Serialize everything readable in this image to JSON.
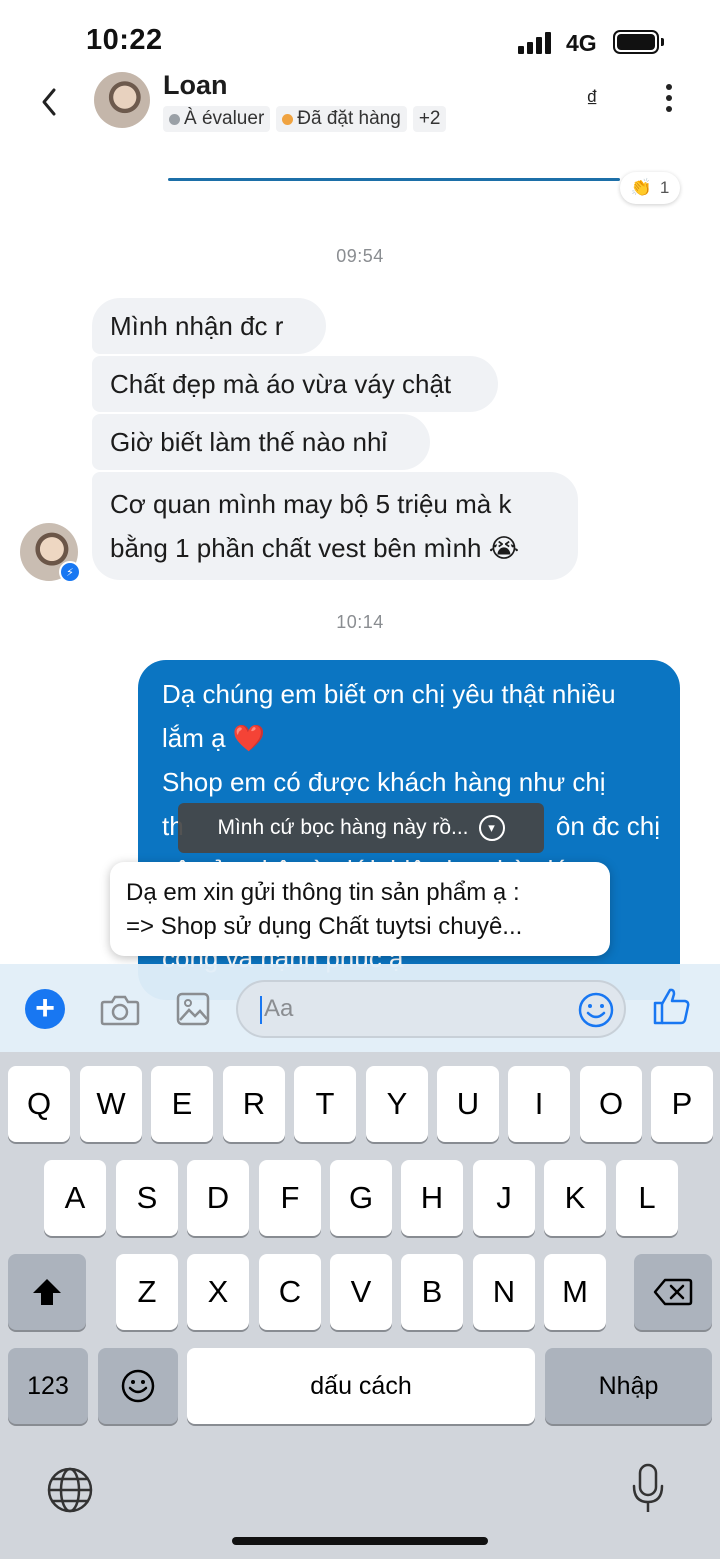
{
  "status_bar": {
    "time": "10:22",
    "network": "4G"
  },
  "header": {
    "contact_name": "Loan",
    "tags": [
      {
        "label": "À évaluer",
        "dot_color": "#9aa0a6"
      },
      {
        "label": "Đã đặt hàng",
        "dot_color": "#f0a340"
      },
      {
        "label": "+2"
      }
    ],
    "currency_symbol": "₫"
  },
  "reaction": {
    "emoji": "👏",
    "count": "1"
  },
  "timestamps": {
    "first": "09:54",
    "second": "10:14"
  },
  "incoming_messages": [
    "Mình nhận đc r",
    "Chất đẹp mà áo vừa váy chật",
    "Giờ biết làm thế nào nhỉ",
    "Cơ quan mình may bộ 5 triệu mà k",
    "bằng 1 phần chất vest bên mình 😭"
  ],
  "outgoing_message": {
    "lines": [
      "Dạ chúng em biết ơn chị yêu thật nhiều",
      "lắm ạ ❤️",
      "Shop em có được khách hàng như chị",
      "th",
      "ôn đc chị",
      "yêu ủng hộ và giới thiệu bạn bè giúp",
      "",
      "công và hạnh phúc ạ"
    ]
  },
  "tooltip_dark": {
    "text": "Mình cứ bọc hàng này rồ...",
    "icon": "chevron-down-circle-icon"
  },
  "tooltip_light": {
    "line1": "Dạ em xin gửi thông tin sản phẩm ạ :",
    "line2": "=> Shop sử dụng Chất tuytsi chuyê..."
  },
  "composer": {
    "placeholder": "Aa",
    "accent_color": "#1877f2"
  },
  "keyboard": {
    "row1": [
      "Q",
      "W",
      "E",
      "R",
      "T",
      "Y",
      "U",
      "I",
      "O",
      "P"
    ],
    "row2": [
      "A",
      "S",
      "D",
      "F",
      "G",
      "H",
      "J",
      "K",
      "L"
    ],
    "row3": [
      "Z",
      "X",
      "C",
      "V",
      "B",
      "N",
      "M"
    ],
    "numbers_label": "123",
    "space_label": "dấu cách",
    "return_label": "Nhập"
  },
  "colors": {
    "outgoing_bubble": "#0b75c2",
    "incoming_bubble": "#f0f2f5",
    "keyboard_bg": "#d1d5db"
  }
}
